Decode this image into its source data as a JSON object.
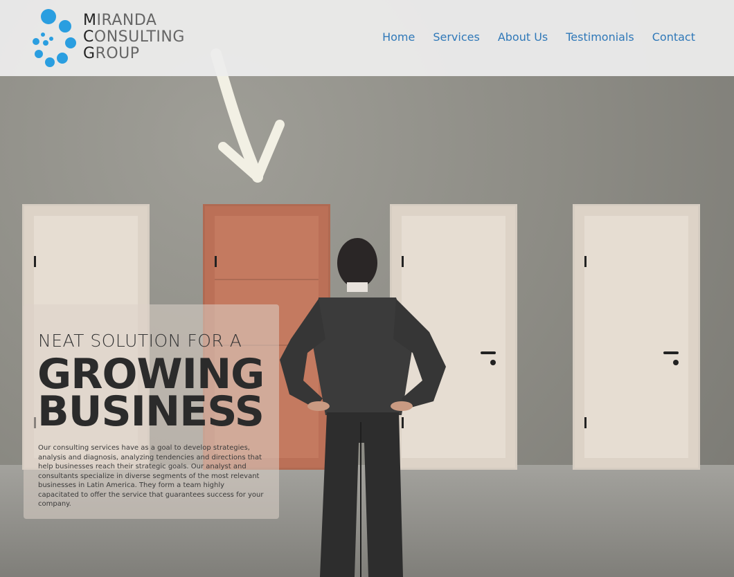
{
  "brand": {
    "logo_lines": [
      "MIRANDA",
      "CONSULTING",
      "GROUP"
    ]
  },
  "nav": {
    "items": [
      "Home",
      "Services",
      "About Us",
      "Testimonials",
      "Contact"
    ]
  },
  "hero": {
    "kicker": "NEAT SOLUTION FOR A",
    "headline_line1": "GROWING",
    "headline_line2": "BUSINESS",
    "description": "Our consulting services have as a goal to develop strategies, analysis and diagnosis, analyzing tendencies and directions that help businesses reach their strategic goals. Our analyst and consultants specialize in diverse segments of the most relevant businesses in Latin America. They form a team highly capacitated to offer the service that guarantees success for your company."
  },
  "colors": {
    "nav_link": "#2f78b8",
    "logo_blue": "#2a9ee0",
    "accent_door": "#c47a60"
  }
}
